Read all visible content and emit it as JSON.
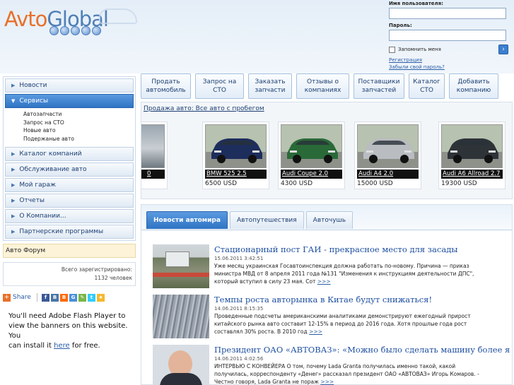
{
  "logo": {
    "part1": "Avto",
    "part2": "Global"
  },
  "login": {
    "username_label": "Имя пользователя:",
    "password_label": "Пароль:",
    "remember_label": "Запомнить меня",
    "go_label": "›",
    "register_link": "Регистрация",
    "forgot_link": "Забыли свой пароль?"
  },
  "sidebar": {
    "items": [
      {
        "label": "Новости"
      },
      {
        "label": "Сервисы"
      },
      {
        "label": "Каталог компаний"
      },
      {
        "label": "Обслуживание авто"
      },
      {
        "label": "Мой гараж"
      },
      {
        "label": "Отчеты"
      },
      {
        "label": "О Компании..."
      },
      {
        "label": "Партнерские программы"
      }
    ],
    "subitems": [
      "Автозапчасти",
      "Запрос на СТО",
      "Новые авто",
      "Подержаные авто"
    ],
    "forum": "Авто Форум",
    "stats_line1": "Всего зарегистрировано:",
    "stats_line2": "1132 человек",
    "share_label": "Share",
    "flash_line1": "You'll need Adobe Flash Player to",
    "flash_line2": "view the banners on this website. You",
    "flash_line3a": "can install it ",
    "flash_link": "here",
    "flash_line3b": " for free."
  },
  "topbuttons": [
    {
      "line1": "Продать",
      "line2": "автомобиль"
    },
    {
      "line1": "Запрос на",
      "line2": "СТО"
    },
    {
      "line1": "Заказать",
      "line2": "запчасти"
    },
    {
      "line1": "Отзывы о",
      "line2": "компаниях"
    },
    {
      "line1": "Поставщики",
      "line2": "запчастей"
    },
    {
      "line1": "Каталог",
      "line2": "СТО"
    },
    {
      "line1": "Добавить",
      "line2": "компанию"
    }
  ],
  "sale": {
    "title": "Продажа авто: Все авто с пробегом",
    "cars": [
      {
        "name": "0",
        "price": ""
      },
      {
        "name": "BMW 525 2.5",
        "price": "6500 USD",
        "color": "#1d2d5c"
      },
      {
        "name": "Audi Coupe 2.0",
        "price": "4300 USD",
        "color": "#2a6a38"
      },
      {
        "name": "Audi A4 2.0",
        "price": "15000 USD",
        "color": "#b9bcc0"
      },
      {
        "name": "Audi A6 Allroad 2.7",
        "price": "19300 USD",
        "color": "#2e3338"
      }
    ]
  },
  "news": {
    "tabs": [
      "Новости автомира",
      "Автопутешествия",
      "Авточушь"
    ],
    "items": [
      {
        "title": "Стационарный пост ГАИ - прекрасное место для засады",
        "date": "15.06.2011 3:42:51",
        "text1": "Уже месяц украинская Госавтоинспекция должна работать по-новому. Причина — приказ",
        "text2": "министра МВД от 8 апреля 2011 года №131 \"Изменения к инструкциям деятельности ДПС\",",
        "text3": "который вступил в силу 23 мая. Сот ",
        "more": ">>>"
      },
      {
        "title": "Темпы роста авторынка в Китае будут снижаться!",
        "date": "14.06.2011 8:15:35",
        "text1": "Проведенные подсчеты американскими аналитиками демонстрируют ежегодный прирост",
        "text2": "китайского рынка авто составит 12-15%  в период до 2016 года. Хотя прошлые года рост",
        "text3": "составлял 30% роста. В 2010 год ",
        "more": ">>>"
      },
      {
        "title": "Президент ОАО «АВТОВАЗ»: «Можно было сделать машину более яр",
        "date": "14.06.2011 4:02:56",
        "text1": "ИНТЕРВЬЮ С КОНВЕЙЕРА О том, почему Lada Granta получилась именно такой, какой",
        "text2": "получилась, корреспонденту «Денег» рассказал президент ОАО «АВТОВАЗ» Игорь Комаров. -",
        "text3": "Честно говоря, Lada Granta не пораж ",
        "more": ">>>"
      }
    ]
  }
}
